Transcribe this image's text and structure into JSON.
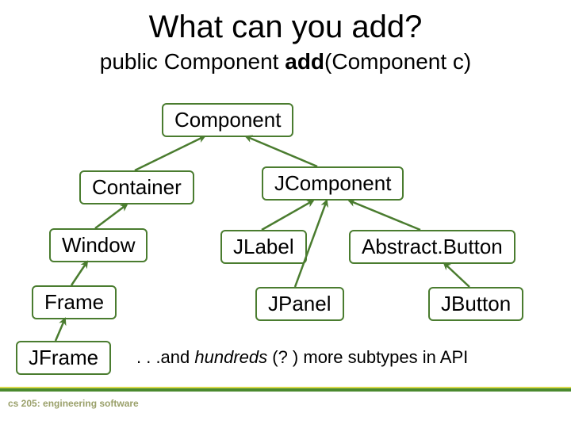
{
  "title": "What can you add?",
  "subtitle": {
    "pre": "public Component ",
    "bold": "add",
    "post": "(Component c)"
  },
  "nodes": {
    "component": "Component",
    "container": "Container",
    "jcomponent": "JComponent",
    "window": "Window",
    "jlabel": "JLabel",
    "abstractbutton": "Abstract.Button",
    "frame": "Frame",
    "jpanel": "JPanel",
    "jbutton": "JButton",
    "jframe": "JFrame"
  },
  "note": {
    "pre": ". . .and ",
    "italic": "hundreds",
    "post": " (? ) more subtypes in API"
  },
  "footer": "cs 205: engineering software",
  "edges": [
    {
      "from": "container",
      "to": "component"
    },
    {
      "from": "jcomponent",
      "to": "component"
    },
    {
      "from": "window",
      "to": "container"
    },
    {
      "from": "frame",
      "to": "window"
    },
    {
      "from": "jframe",
      "to": "frame"
    },
    {
      "from": "jlabel",
      "to": "jcomponent"
    },
    {
      "from": "abstractbutton",
      "to": "jcomponent"
    },
    {
      "from": "jpanel",
      "to": "jcomponent"
    },
    {
      "from": "jbutton",
      "to": "abstractbutton"
    }
  ]
}
